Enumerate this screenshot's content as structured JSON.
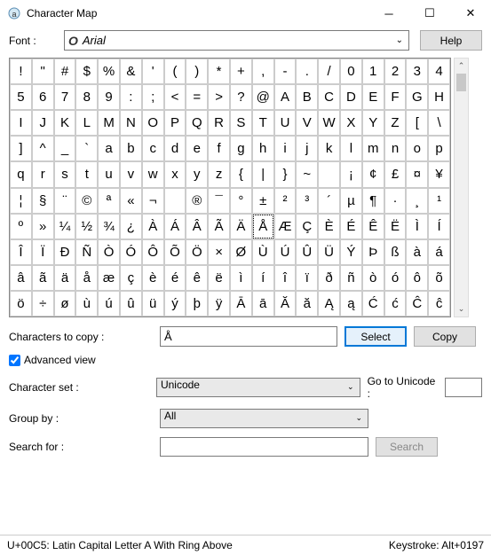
{
  "window": {
    "title": "Character Map"
  },
  "font": {
    "label": "Font :",
    "value": "Arial",
    "help": "Help"
  },
  "grid": {
    "rows": [
      [
        "!",
        "\"",
        "#",
        "$",
        "%",
        "&",
        "'",
        "(",
        ")",
        "*",
        "+",
        ",",
        "-",
        ".",
        "/",
        "0",
        "1",
        "2",
        "3",
        "4"
      ],
      [
        "5",
        "6",
        "7",
        "8",
        "9",
        ":",
        ";",
        "<",
        "=",
        ">",
        "?",
        "@",
        "A",
        "B",
        "C",
        "D",
        "E",
        "F",
        "G",
        "H"
      ],
      [
        "I",
        "J",
        "K",
        "L",
        "M",
        "N",
        "O",
        "P",
        "Q",
        "R",
        "S",
        "T",
        "U",
        "V",
        "W",
        "X",
        "Y",
        "Z",
        "[",
        "\\"
      ],
      [
        "]",
        "^",
        "_",
        "`",
        "a",
        "b",
        "c",
        "d",
        "e",
        "f",
        "g",
        "h",
        "i",
        "j",
        "k",
        "l",
        "m",
        "n",
        "o",
        "p"
      ],
      [
        "q",
        "r",
        "s",
        "t",
        "u",
        "v",
        "w",
        "x",
        "y",
        "z",
        "{",
        "|",
        "}",
        "~",
        "",
        "¡",
        "¢",
        "£",
        "¤",
        "¥"
      ],
      [
        "¦",
        "§",
        "¨",
        "©",
        "ª",
        "«",
        "¬",
        "­",
        "®",
        "¯",
        "°",
        "±",
        "²",
        "³",
        "´",
        "µ",
        "¶",
        "·",
        "¸",
        "¹"
      ],
      [
        "º",
        "»",
        "¼",
        "½",
        "¾",
        "¿",
        "À",
        "Á",
        "Â",
        "Ã",
        "Ä",
        "Å",
        "Æ",
        "Ç",
        "È",
        "É",
        "Ê",
        "Ë",
        "Ì",
        "Í"
      ],
      [
        "Î",
        "Ï",
        "Ð",
        "Ñ",
        "Ò",
        "Ó",
        "Ô",
        "Õ",
        "Ö",
        "×",
        "Ø",
        "Ù",
        "Ú",
        "Û",
        "Ü",
        "Ý",
        "Þ",
        "ß",
        "à",
        "á"
      ],
      [
        "â",
        "ã",
        "ä",
        "å",
        "æ",
        "ç",
        "è",
        "é",
        "ê",
        "ë",
        "ì",
        "í",
        "î",
        "ï",
        "ð",
        "ñ",
        "ò",
        "ó",
        "ô",
        "õ"
      ],
      [
        "ö",
        "÷",
        "ø",
        "ù",
        "ú",
        "û",
        "ü",
        "ý",
        "þ",
        "ÿ",
        "Ā",
        "ā",
        "Ă",
        "ă",
        "Ą",
        "ą",
        "Ć",
        "ć",
        "Ĉ",
        "ĉ"
      ]
    ],
    "selected": {
      "row": 6,
      "col": 11
    }
  },
  "copy": {
    "label": "Characters to copy :",
    "value": "Å",
    "select": "Select",
    "copy": "Copy"
  },
  "advanced": {
    "label": "Advanced view",
    "checked": true
  },
  "charset": {
    "label": "Character set :",
    "value": "Unicode"
  },
  "goto": {
    "label": "Go to Unicode :",
    "value": ""
  },
  "group": {
    "label": "Group by :",
    "value": "All"
  },
  "search": {
    "label": "Search for :",
    "value": "",
    "button": "Search"
  },
  "status": {
    "left": "U+00C5: Latin Capital Letter A With Ring Above",
    "right": "Keystroke: Alt+0197"
  }
}
